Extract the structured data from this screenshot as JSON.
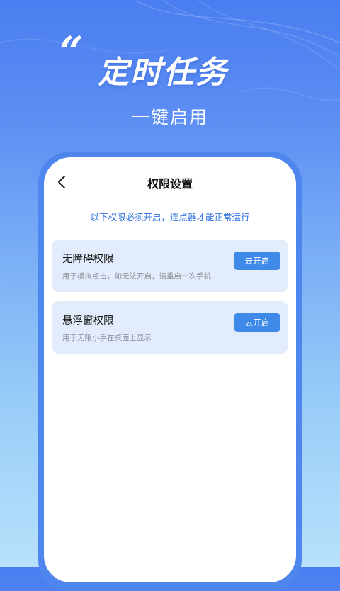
{
  "hero": {
    "quote_mark": "“",
    "title": "定时任务",
    "subtitle": "一键启用"
  },
  "screen": {
    "title": "权限设置",
    "notice": "以下权限必须开启，连点器才能正常运行"
  },
  "permissions": [
    {
      "title": "无障碍权限",
      "description": "用于模拟点击，如无法开启，请重启一次手机",
      "button": "去开启"
    },
    {
      "title": "悬浮窗权限",
      "description": "用于无限小手在桌面上显示",
      "button": "去开启"
    }
  ],
  "colors": {
    "accent": "#3f8ae9",
    "notice_text": "#2f73e0",
    "card_bg": "#e3ecfb",
    "frame": "#4f86ee"
  },
  "icons": {
    "back": "chevron-left-icon"
  }
}
